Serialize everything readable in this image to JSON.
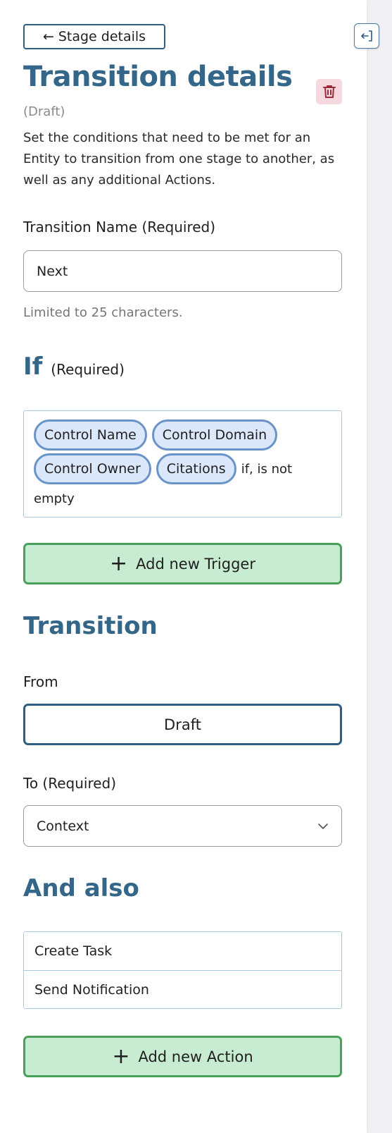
{
  "panel": {
    "back_button": {
      "arrow": "←",
      "label": "Stage details"
    },
    "title": "Transition details",
    "status": "(Draft)",
    "description": "Set the conditions that need to be met for an Entity to transition from one stage to another, as well as any additional Actions.",
    "delete_icon": "trash-icon",
    "collapse_icon": "collapse-panel-icon"
  },
  "name_field": {
    "label": "Transition Name (Required)",
    "value": "Next",
    "hint": "Limited to 25 characters."
  },
  "if_section": {
    "title": "If",
    "required": "(Required)",
    "chips": [
      "Control Name",
      "Control Domain",
      "Control Owner",
      "Citations"
    ],
    "condition_text": "if, is not empty",
    "add_button": "Add new Trigger"
  },
  "transition_section": {
    "title": "Transition",
    "from_label": "From",
    "from_value": "Draft",
    "to_label": "To (Required)",
    "to_value": "Context"
  },
  "also_section": {
    "title": "And also",
    "actions": [
      "Create Task",
      "Send Notification"
    ],
    "add_button": "Add new Action"
  },
  "colors": {
    "heading": "#336688",
    "green_button_bg": "#c8ecd2",
    "green_button_border": "#49a05a",
    "chip_bg": "#dbe7fb",
    "chip_border": "#6a94c8",
    "delete_bg": "#f6d9df",
    "delete_icon": "#9a2b3b"
  }
}
